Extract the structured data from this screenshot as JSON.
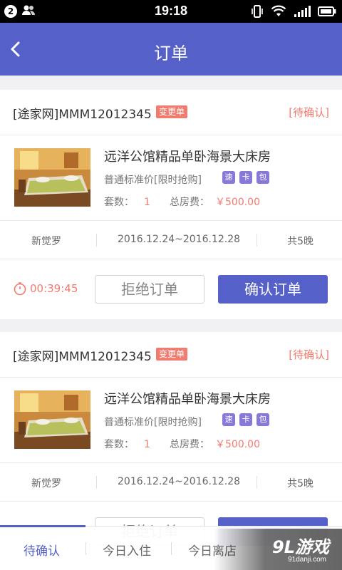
{
  "statusbar": {
    "notification_count": "2",
    "time": "19:18"
  },
  "navbar": {
    "title": "订单"
  },
  "orders": [
    {
      "order_no": "[途家网]MMM12012345",
      "change_badge": "变更单",
      "status": "[待确认]",
      "hotel_name": "远洋公馆精品单卧海景大床房",
      "room_type": "普通标准价[限时抢购]",
      "tags": [
        "速",
        "卡",
        "包"
      ],
      "rooms_label": "套数：",
      "rooms_value": "1",
      "total_label": "总房费：",
      "total_value": "￥500.00",
      "guest": "新觉罗",
      "dates": "2016.12.24~2016.12.28",
      "nights": "共5晚",
      "timer": "00:39:45",
      "reject_label": "拒绝订单",
      "confirm_label": "确认订单"
    },
    {
      "order_no": "[途家网]MMM12012345",
      "change_badge": "变更单",
      "status": "[待确认]",
      "hotel_name": "远洋公馆精品单卧海景大床房",
      "room_type": "普通标准价[限时抢购]",
      "tags": [
        "速",
        "卡",
        "包"
      ],
      "rooms_label": "套数：",
      "rooms_value": "1",
      "total_label": "总房费：",
      "total_value": "￥500.00",
      "guest": "新觉罗",
      "dates": "2016.12.24~2016.12.28",
      "nights": "共5晚",
      "reject_label": "拒绝订单"
    }
  ],
  "tabs": [
    {
      "label": "待确认",
      "active": true
    },
    {
      "label": "今日入住",
      "active": false
    },
    {
      "label": "今日离店",
      "active": false
    }
  ],
  "watermark": {
    "logo": "9L游戏",
    "url": "91danji.com"
  },
  "colors": {
    "primary": "#5560c8",
    "accent": "#f27b6f",
    "tag": "#8878d8"
  }
}
